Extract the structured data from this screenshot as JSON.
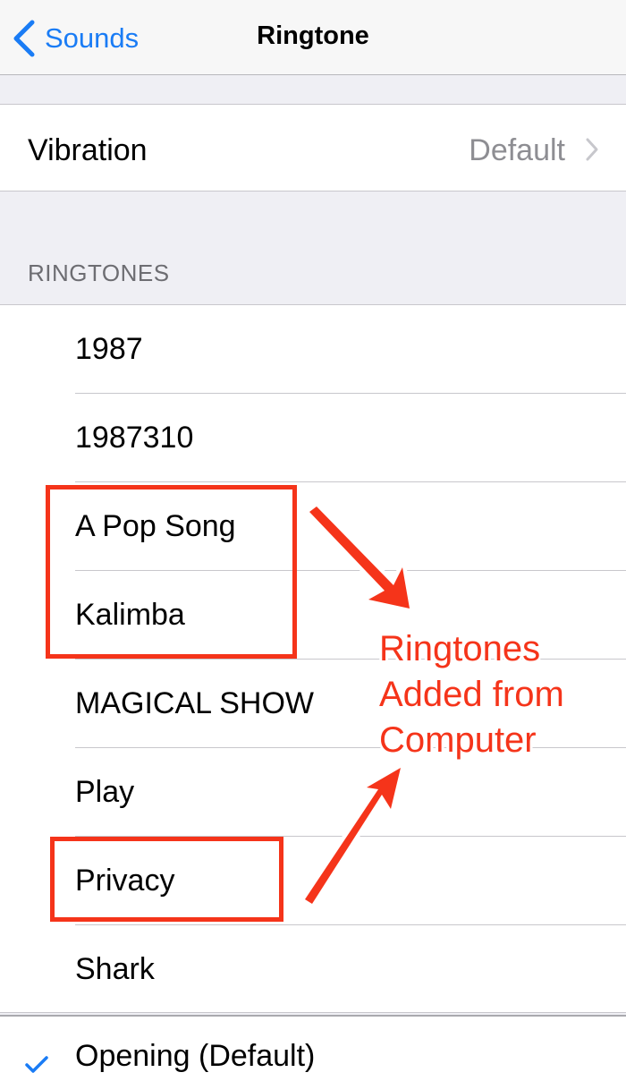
{
  "navbar": {
    "back_label": "Sounds",
    "title": "Ringtone"
  },
  "vibration": {
    "label": "Vibration",
    "value": "Default"
  },
  "ringtones_section": {
    "header": "RINGTONES",
    "items": [
      {
        "label": "1987"
      },
      {
        "label": "1987310"
      },
      {
        "label": "A Pop Song"
      },
      {
        "label": "Kalimba"
      },
      {
        "label": "MAGICAL SHOW"
      },
      {
        "label": "Play"
      },
      {
        "label": "Privacy"
      },
      {
        "label": "Shark"
      }
    ]
  },
  "default_ringtone": {
    "label": "Opening (Default)",
    "selected": true
  },
  "annotation": {
    "lines": [
      "Ringtones",
      "Added from",
      "Computer"
    ]
  },
  "colors": {
    "accent": "#1a7cf5",
    "annotation": "#f5341a",
    "secondary_text": "#8e8e93"
  },
  "icons": {
    "back": "chevron-left-icon",
    "disclosure": "chevron-right-icon",
    "selected": "checkmark-icon"
  }
}
